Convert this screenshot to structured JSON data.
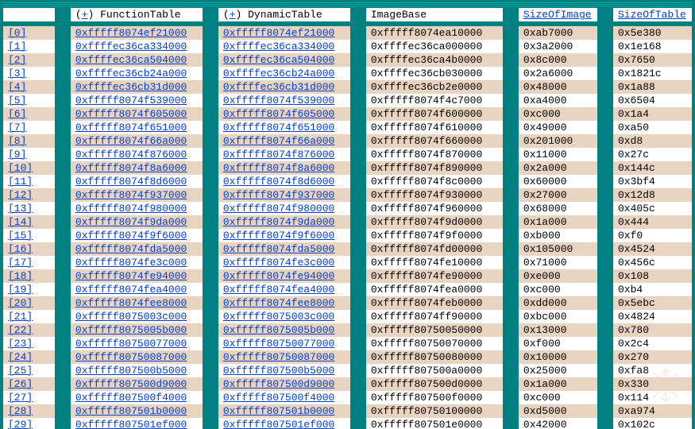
{
  "headers": {
    "index": "",
    "function_table_prefix": "(",
    "function_table_plus": "+",
    "function_table_suffix": ") ",
    "function_table": "FunctionTable",
    "dynamic_table_prefix": "(",
    "dynamic_table_plus": "+",
    "dynamic_table_suffix": ") ",
    "dynamic_table": "DynamicTable",
    "image_base": "ImageBase",
    "size_of_image": "SizeOfImage",
    "size_of_table": "SizeOfTable"
  },
  "rows": [
    {
      "idx": "[0]",
      "ft": "0xfffff8074ef21000",
      "dt": "0xfffff8074ef21000",
      "ib": "0xfffff8074ea10000",
      "si": "0xab7000",
      "st": "0x5e380"
    },
    {
      "idx": "[1]",
      "ft": "0xffffec36ca334000",
      "dt": "0xffffec36ca334000",
      "ib": "0xffffec36ca000000",
      "si": "0x3a2000",
      "st": "0x1e168"
    },
    {
      "idx": "[2]",
      "ft": "0xffffec36ca504000",
      "dt": "0xffffec36ca504000",
      "ib": "0xffffec36ca4b0000",
      "si": "0x8c000",
      "st": "0x7650"
    },
    {
      "idx": "[3]",
      "ft": "0xffffec36cb24a000",
      "dt": "0xffffec36cb24a000",
      "ib": "0xffffec36cb030000",
      "si": "0x2a6000",
      "st": "0x1821c"
    },
    {
      "idx": "[4]",
      "ft": "0xffffec36cb31d000",
      "dt": "0xffffec36cb31d000",
      "ib": "0xffffec36cb2e0000",
      "si": "0x48000",
      "st": "0x1a88"
    },
    {
      "idx": "[5]",
      "ft": "0xfffff8074f539000",
      "dt": "0xfffff8074f539000",
      "ib": "0xfffff8074f4c7000",
      "si": "0xa4000",
      "st": "0x6504"
    },
    {
      "idx": "[6]",
      "ft": "0xfffff8074f605000",
      "dt": "0xfffff8074f605000",
      "ib": "0xfffff8074f600000",
      "si": "0xc000",
      "st": "0x1a4"
    },
    {
      "idx": "[7]",
      "ft": "0xfffff8074f651000",
      "dt": "0xfffff8074f651000",
      "ib": "0xfffff8074f610000",
      "si": "0x49000",
      "st": "0xa50"
    },
    {
      "idx": "[8]",
      "ft": "0xfffff8074f66a000",
      "dt": "0xfffff8074f66a000",
      "ib": "0xfffff8074f660000",
      "si": "0x201000",
      "st": "0xd8"
    },
    {
      "idx": "[9]",
      "ft": "0xfffff8074f876000",
      "dt": "0xfffff8074f876000",
      "ib": "0xfffff8074f870000",
      "si": "0x11000",
      "st": "0x27c"
    },
    {
      "idx": "[10]",
      "ft": "0xfffff8074f8a6000",
      "dt": "0xfffff8074f8a6000",
      "ib": "0xfffff8074f890000",
      "si": "0x2a000",
      "st": "0x144c"
    },
    {
      "idx": "[11]",
      "ft": "0xfffff8074f8d6000",
      "dt": "0xfffff8074f8d6000",
      "ib": "0xfffff8074f8c0000",
      "si": "0x60000",
      "st": "0x3bf4"
    },
    {
      "idx": "[12]",
      "ft": "0xfffff8074f937000",
      "dt": "0xfffff8074f937000",
      "ib": "0xfffff8074f930000",
      "si": "0x27000",
      "st": "0x12d8"
    },
    {
      "idx": "[13]",
      "ft": "0xfffff8074f980000",
      "dt": "0xfffff8074f980000",
      "ib": "0xfffff8074f960000",
      "si": "0x68000",
      "st": "0x405c"
    },
    {
      "idx": "[14]",
      "ft": "0xfffff8074f9da000",
      "dt": "0xfffff8074f9da000",
      "ib": "0xfffff8074f9d0000",
      "si": "0x1a000",
      "st": "0x444"
    },
    {
      "idx": "[15]",
      "ft": "0xfffff8074f9f6000",
      "dt": "0xfffff8074f9f6000",
      "ib": "0xfffff8074f9f0000",
      "si": "0xb000",
      "st": "0xf0"
    },
    {
      "idx": "[16]",
      "ft": "0xfffff8074fda5000",
      "dt": "0xfffff8074fda5000",
      "ib": "0xfffff8074fd00000",
      "si": "0x105000",
      "st": "0x4524"
    },
    {
      "idx": "[17]",
      "ft": "0xfffff8074fe3c000",
      "dt": "0xfffff8074fe3c000",
      "ib": "0xfffff8074fe10000",
      "si": "0x71000",
      "st": "0x456c"
    },
    {
      "idx": "[18]",
      "ft": "0xfffff8074fe94000",
      "dt": "0xfffff8074fe94000",
      "ib": "0xfffff8074fe90000",
      "si": "0xe000",
      "st": "0x108"
    },
    {
      "idx": "[19]",
      "ft": "0xfffff8074fea4000",
      "dt": "0xfffff8074fea4000",
      "ib": "0xfffff8074fea0000",
      "si": "0xc000",
      "st": "0xb4"
    },
    {
      "idx": "[20]",
      "ft": "0xfffff8074fee8000",
      "dt": "0xfffff8074fee8000",
      "ib": "0xfffff8074feb0000",
      "si": "0xdd000",
      "st": "0x5ebc"
    },
    {
      "idx": "[21]",
      "ft": "0xfffff8075003c000",
      "dt": "0xfffff8075003c000",
      "ib": "0xfffff8074ff90000",
      "si": "0xbc000",
      "st": "0x4824"
    },
    {
      "idx": "[22]",
      "ft": "0xfffff8075005b000",
      "dt": "0xfffff8075005b000",
      "ib": "0xfffff80750050000",
      "si": "0x13000",
      "st": "0x780"
    },
    {
      "idx": "[23]",
      "ft": "0xfffff80750077000",
      "dt": "0xfffff80750077000",
      "ib": "0xfffff80750070000",
      "si": "0xf000",
      "st": "0x2c4"
    },
    {
      "idx": "[24]",
      "ft": "0xfffff80750087000",
      "dt": "0xfffff80750087000",
      "ib": "0xfffff80750080000",
      "si": "0x10000",
      "st": "0x270"
    },
    {
      "idx": "[25]",
      "ft": "0xfffff807500b5000",
      "dt": "0xfffff807500b5000",
      "ib": "0xfffff807500a0000",
      "si": "0x25000",
      "st": "0xfa8"
    },
    {
      "idx": "[26]",
      "ft": "0xfffff807500d9000",
      "dt": "0xfffff807500d9000",
      "ib": "0xfffff807500d0000",
      "si": "0x1a000",
      "st": "0x330"
    },
    {
      "idx": "[27]",
      "ft": "0xfffff807500f4000",
      "dt": "0xfffff807500f4000",
      "ib": "0xfffff807500f0000",
      "si": "0xc000",
      "st": "0x114"
    },
    {
      "idx": "[28]",
      "ft": "0xfffff807501b0000",
      "dt": "0xfffff807501b0000",
      "ib": "0xfffff80750100000",
      "si": "0xd5000",
      "st": "0xa974"
    },
    {
      "idx": "[29]",
      "ft": "0xfffff807501ef000",
      "dt": "0xfffff807501ef000",
      "ib": "0xfffff807501e0000",
      "si": "0x42000",
      "st": "0x102c"
    }
  ]
}
